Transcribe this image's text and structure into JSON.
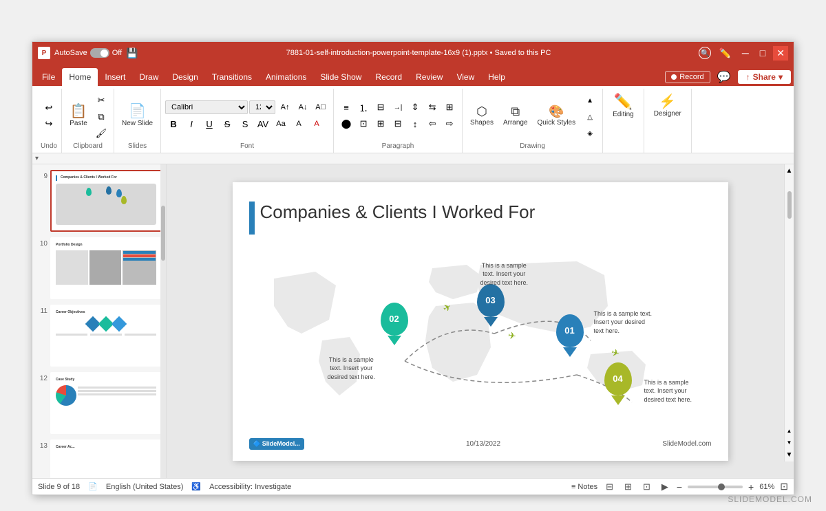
{
  "window": {
    "title": "7881-01-self-introduction-powerpoint-template-16x9 (1).pptx • Saved to this PC",
    "autosave": "AutoSave",
    "autosave_state": "Off"
  },
  "ribbon": {
    "tabs": [
      "File",
      "Home",
      "Insert",
      "Draw",
      "Design",
      "Transitions",
      "Animations",
      "Slide Show",
      "Record",
      "Review",
      "View",
      "Help"
    ],
    "active_tab": "Home",
    "record_label": "Record",
    "share_label": "Share",
    "groups": {
      "undo": "Undo",
      "clipboard": "Clipboard",
      "slides": "Slides",
      "font": "Font",
      "paragraph": "Paragraph",
      "drawing": "Drawing",
      "designer": "Designer"
    },
    "paste_label": "Paste",
    "new_slide_label": "New Slide",
    "shapes_label": "Shapes",
    "arrange_label": "Arrange",
    "quick_styles_label": "Quick Styles",
    "editing_label": "Editing",
    "designer_label": "Designer"
  },
  "slides": [
    {
      "number": "9",
      "active": true
    },
    {
      "number": "10",
      "active": false
    },
    {
      "number": "11",
      "active": false
    },
    {
      "number": "12",
      "active": false
    },
    {
      "number": "13",
      "active": false
    }
  ],
  "slide_content": {
    "title": "Companies & Clients I Worked For",
    "date": "10/13/2022",
    "footer_brand": "SlideModel.com",
    "logo_text": "SlideModel...",
    "pins": [
      {
        "id": "01",
        "color": "#2980b9",
        "label": "01"
      },
      {
        "id": "02",
        "color": "#1abc9c",
        "label": "02"
      },
      {
        "id": "03",
        "color": "#2471a3",
        "label": "03"
      },
      {
        "id": "04",
        "color": "#a8b828",
        "label": "04"
      }
    ],
    "callouts": [
      {
        "id": "top",
        "text": "This is a sample text. Insert your desired text here."
      },
      {
        "id": "right",
        "text": "This is a sample text. Insert your desired text here."
      },
      {
        "id": "bottom-left",
        "text": "This is a sample text. Insert your desired text here."
      },
      {
        "id": "bottom-right",
        "text": "This is a sample text. Insert your desired text here."
      }
    ]
  },
  "statusbar": {
    "slide_info": "Slide 9 of 18",
    "language": "English (United States)",
    "accessibility": "Accessibility: Investigate",
    "notes_label": "Notes",
    "zoom_level": "61%"
  },
  "watermark": "SLIDEMODEL.COM"
}
